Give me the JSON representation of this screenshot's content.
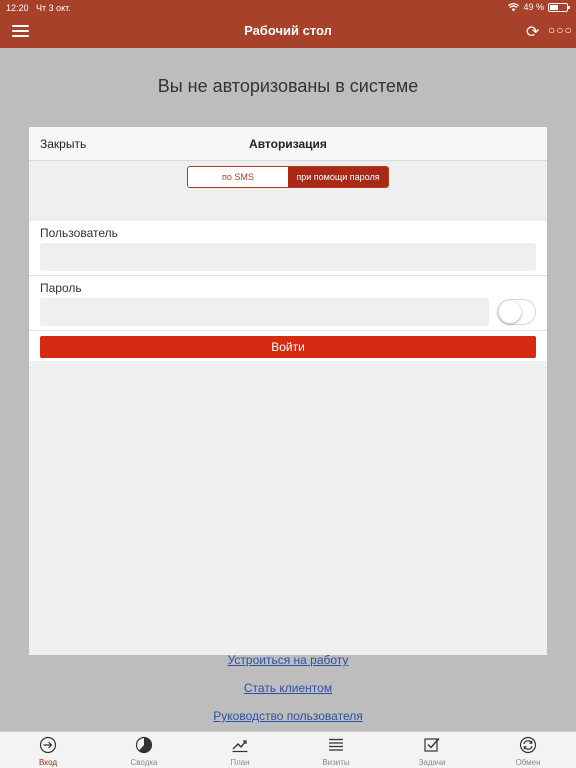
{
  "status_bar": {
    "time": "12:20",
    "date": "Чт 3 окт.",
    "battery": "49 %",
    "battery_level": 0.49
  },
  "nav": {
    "title": "Рабочий стол"
  },
  "page": {
    "heading": "Вы не авторизованы в системе"
  },
  "modal": {
    "close_label": "Закрыть",
    "title": "Авторизация",
    "segments": [
      {
        "label": "по SMS",
        "active": false
      },
      {
        "label": "при помощи пароля",
        "active": true
      }
    ],
    "user_label": "Пользователь",
    "user_value": "",
    "password_label": "Пароль",
    "password_value": "",
    "show_password_toggle": false,
    "login_label": "Войти"
  },
  "links": [
    "Устроиться на работу",
    "Стать клиентом",
    "Руководство пользователя"
  ],
  "tabs": [
    {
      "label": "Вход",
      "icon": "login-icon",
      "active": true
    },
    {
      "label": "Сводка",
      "icon": "pie-chart-icon",
      "active": false
    },
    {
      "label": "План",
      "icon": "trend-chart-icon",
      "active": false
    },
    {
      "label": "Визиты",
      "icon": "list-icon",
      "active": false
    },
    {
      "label": "Задачи",
      "icon": "tasks-icon",
      "active": false
    },
    {
      "label": "Обмен",
      "icon": "sync-icon",
      "active": false
    }
  ],
  "colors": {
    "brand": "#a8412a",
    "accent": "#d42b12",
    "link": "#2e4fa3"
  }
}
